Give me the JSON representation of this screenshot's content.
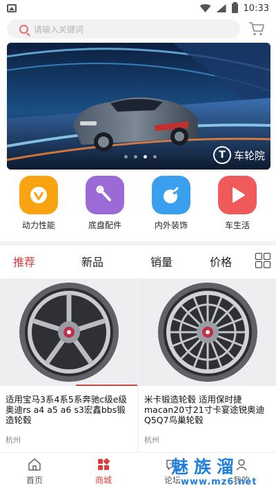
{
  "status_bar": {
    "time": "10:33",
    "icons": [
      "gallery-icon",
      "wifi-icon",
      "signal-icon",
      "battery-icon"
    ]
  },
  "search": {
    "placeholder": "请输入关键词"
  },
  "cart_icon": "cart-icon",
  "banner": {
    "logo_text": "车轮院",
    "slide_count": 4,
    "active_slide": 3
  },
  "categories": [
    {
      "label": "动力性能",
      "icon": "heart-v-icon",
      "color": "#f7a312"
    },
    {
      "label": "底盘配件",
      "icon": "wrench-icon",
      "color": "#9b6ad6"
    },
    {
      "label": "内外装饰",
      "icon": "bomb-icon",
      "color": "#3b9ff0"
    },
    {
      "label": "车生活",
      "icon": "play-icon",
      "color": "#f05a5a"
    }
  ],
  "sort_tabs": [
    {
      "label": "推荐",
      "active": true
    },
    {
      "label": "新品",
      "active": false
    },
    {
      "label": "销量",
      "active": false
    },
    {
      "label": "价格",
      "active": false
    }
  ],
  "products": [
    {
      "title": "适用宝马3系4系5系奔驰c级e级奥迪rs a4 a5 a6 s3宏鑫bbs锻造轮毂",
      "city": "杭州",
      "image": "wheel-5-spoke"
    },
    {
      "title": "米卡锻造轮毂 适用保时捷macan20寸21寸卡宴途锐奥迪Q5Q7鸟巢轮毂",
      "city": "杭州",
      "image": "wheel-mesh"
    }
  ],
  "tabbar": [
    {
      "label": "首页",
      "icon": "home-icon",
      "active": false
    },
    {
      "label": "商城",
      "icon": "shop-icon",
      "active": true
    },
    {
      "label": "论坛",
      "icon": "forum-icon",
      "active": false
    },
    {
      "label": "我的",
      "icon": "user-icon",
      "active": false
    }
  ],
  "watermark": {
    "text": "魅族溜",
    "url": "www.mz6.net"
  },
  "colors": {
    "accent": "#e03b3b",
    "watermark": "#1e7fe0"
  }
}
